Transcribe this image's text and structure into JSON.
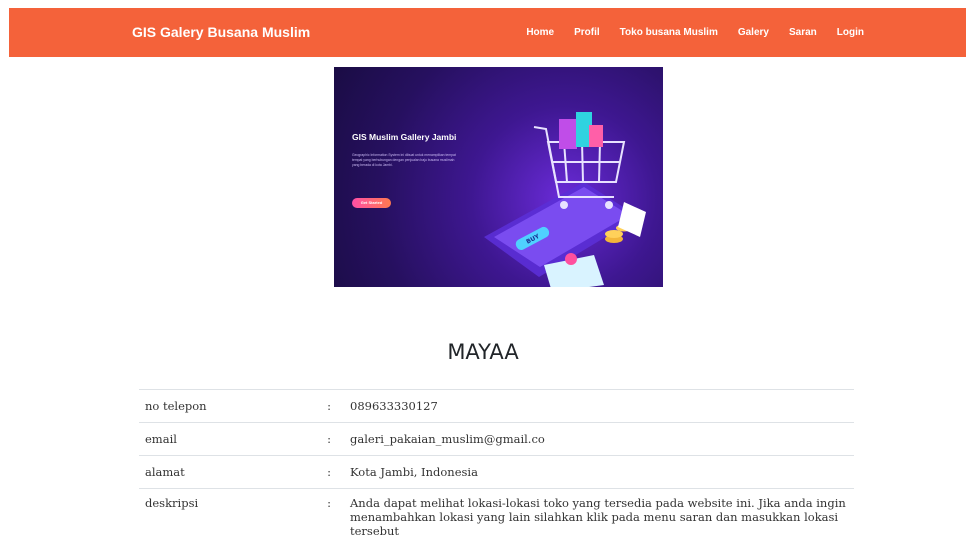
{
  "navbar": {
    "brand": "GIS Galery Busana Muslim",
    "links": [
      "Home",
      "Profil",
      "Toko busana Muslim",
      "Galery",
      "Saran",
      "Login"
    ],
    "color": "#f4623a"
  },
  "banner": {
    "title": "GIS Muslim Gallery Jambi",
    "text": "Geographic Information System ini dibuat untuk menampilkan tempat tempat yang berhubungan dengan penjualan baju busana muslimah yang berada di kota Jambi.",
    "button": "Get Started",
    "buy_label": "BUY"
  },
  "page_title": "MAYAA",
  "details": [
    {
      "label": "no telepon",
      "sep": ":",
      "value": "089633330127"
    },
    {
      "label": "email",
      "sep": ":",
      "value": "galeri_pakaian_muslim@gmail.co"
    },
    {
      "label": "alamat",
      "sep": ":",
      "value": "Kota Jambi, Indonesia"
    },
    {
      "label": "deskripsi",
      "sep": ":",
      "value": "Anda dapat melihat lokasi-lokasi toko yang tersedia pada website ini. Jika anda ingin menambahkan lokasi yang lain silahkan klik pada menu saran dan masukkan lokasi tersebut"
    }
  ]
}
